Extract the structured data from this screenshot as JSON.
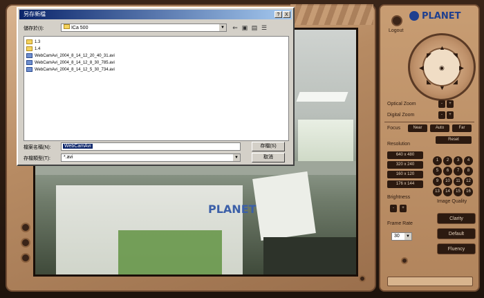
{
  "dialog": {
    "title": "另存新檔",
    "help_btn": "?",
    "close_btn": "X",
    "save_in_label": "儲存於(I):",
    "save_in_value": "ICa 500",
    "file_list": [
      {
        "name": "1.3",
        "type": "folder"
      },
      {
        "name": "1.4",
        "type": "folder"
      },
      {
        "name": "WebCamAvi_2004_8_14_12_20_40_31.avi",
        "type": "file"
      },
      {
        "name": "WebCamAvi_2004_8_14_12_8_30_785.avi",
        "type": "file"
      },
      {
        "name": "WebCamAvi_2004_8_14_12_5_30_734.avi",
        "type": "file"
      }
    ],
    "filename_label": "檔案名稱(N):",
    "filename_value": "WebCamAvi",
    "filetype_label": "存檔類型(T):",
    "filetype_value": "*.avi",
    "save_button": "存檔(S)",
    "cancel_button": "取消"
  },
  "video": {
    "watermark": "PLANET"
  },
  "panel": {
    "logo": "PLANET",
    "logout": "Logout",
    "optical_zoom_label": "Optical Zoom",
    "digital_zoom_label": "Digital Zoom",
    "zoom_plus": "+",
    "zoom_minus": "-",
    "focus_label": "Focus",
    "focus_near": "Near",
    "focus_auto": "Auto",
    "focus_far": "Far",
    "reset": "Reset",
    "resolution_label": "Resolution",
    "resolutions": [
      "640 x 480",
      "320 x 240",
      "160 x 120",
      "176 x 144"
    ],
    "presets": [
      "1",
      "2",
      "3",
      "4",
      "5",
      "6",
      "7",
      "8",
      "9",
      "10",
      "11",
      "12",
      "13",
      "14",
      "15",
      "16"
    ],
    "brightness_label": "Brightness",
    "image_quality_label": "Image Quality",
    "frame_rate_label": "Frame Rate",
    "frame_rate_value": "30",
    "clarity": "Clarity",
    "default": "Default",
    "fluency": "Fluency"
  }
}
